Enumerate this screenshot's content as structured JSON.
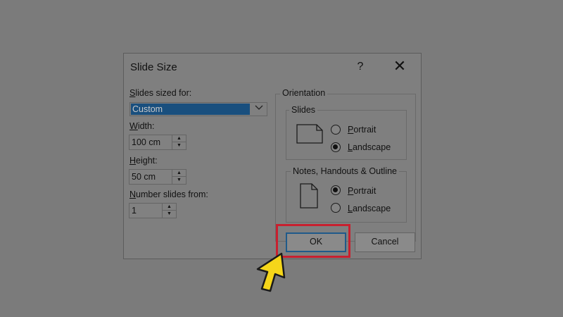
{
  "dialog": {
    "title": "Slide Size",
    "help_glyph": "?",
    "close_glyph": "✕"
  },
  "size": {
    "sized_for_label_mnemonic": "S",
    "sized_for_label_rest": "lides sized for:",
    "sized_for_value": "Custom",
    "width_label_mnemonic": "W",
    "width_label_rest": "idth:",
    "width_value": "100 cm",
    "height_label_mnemonic": "H",
    "height_label_rest": "eight:",
    "height_value": "50 cm",
    "number_label_mnemonic": "N",
    "number_label_rest": "umber slides from:",
    "number_value": "1"
  },
  "orientation": {
    "group_title": "Orientation",
    "slides": {
      "title": "Slides",
      "portrait_mnemonic": "P",
      "portrait_rest": "ortrait",
      "landscape_mnemonic": "L",
      "landscape_rest": "andscape",
      "selected": "landscape"
    },
    "notes": {
      "title": "Notes, Handouts & Outline",
      "portrait_mnemonic": "P",
      "portrait_rest": "ortrait",
      "landscape_mnemonic": "L",
      "landscape_rest": "andscape",
      "selected": "portrait"
    }
  },
  "buttons": {
    "ok": "OK",
    "cancel": "Cancel"
  },
  "colors": {
    "highlight": "#c8202f",
    "cursor_fill": "#f5d61a",
    "selection": "#194f7e"
  }
}
